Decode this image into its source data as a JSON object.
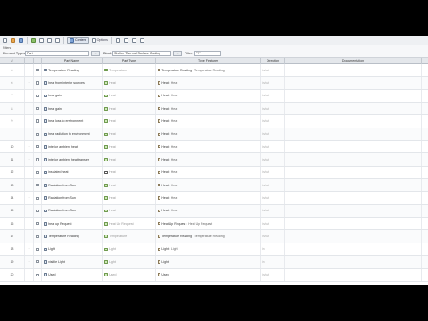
{
  "toolbar": {
    "items": [
      "",
      "",
      "",
      "",
      "",
      "",
      "",
      "",
      ""
    ],
    "toggle_label": "Content",
    "options_label": "Options"
  },
  "filter": {
    "caption": "Filters",
    "element_types_label": "Element Types:",
    "element_types_value": "Part",
    "owner_label": "Block:",
    "owner_value": "Shelter Thermal Surface Cooling",
    "filter_label": "Filter:",
    "filter_value": "\"?\""
  },
  "columns": {
    "num": "#",
    "expand": "",
    "check": "",
    "part_name": "Part Name",
    "part_type": "Part Type",
    "type_features": "Type Features",
    "direction": "Direction",
    "documentation": "Documentation"
  },
  "rows": [
    {
      "num": "6",
      "exp": "",
      "name": "Temperature Reading",
      "type": "Temperature",
      "feat_a": "Temperature Reading",
      "feat_b": "Temperature Reading",
      "dir": "in/out"
    },
    {
      "num": "6",
      "exp": "+",
      "name": "heat from interior sources",
      "type": "Heat",
      "feat_a": "Heat",
      "feat_b": "Heat",
      "dir": "in/out"
    },
    {
      "num": "7",
      "exp": "",
      "name": "heat gain",
      "type": "Heat",
      "feat_a": "Heat",
      "feat_b": "Heat",
      "dir": "in/out"
    },
    {
      "num": "8",
      "exp": "",
      "name": "heat gain",
      "type": "Heat",
      "feat_a": "Heat",
      "feat_b": "Heat",
      "dir": "in/out"
    },
    {
      "num": "9",
      "exp": "",
      "name": "heat loss to environment",
      "type": "Heat",
      "feat_a": "Heat",
      "feat_b": "Heat",
      "dir": "in/out"
    },
    {
      "num": "",
      "exp": "",
      "name": "heat radiation to environment",
      "type": "Heat",
      "feat_a": "Heat",
      "feat_b": "Heat",
      "dir": "in/out"
    },
    {
      "num": "10",
      "exp": "+",
      "name": "interior ambient heat",
      "type": "Heat",
      "feat_a": "Heat",
      "feat_b": "Heat",
      "dir": "in/out"
    },
    {
      "num": "11",
      "exp": "+",
      "name": "interior ambient heat transfer",
      "type": "Heat",
      "feat_a": "Heat",
      "feat_b": "Heat",
      "dir": "in/out"
    },
    {
      "num": "12",
      "exp": "",
      "name": "insulated heat",
      "type": "Heat",
      "feat_a": "Heat",
      "feat_b": "Heat",
      "dir": "in/out"
    },
    {
      "num": "13",
      "exp": "+",
      "name": "Radiation from Sun",
      "type": "Heat",
      "feat_a": "Heat",
      "feat_b": "Heat",
      "dir": "in/out"
    },
    {
      "num": "14",
      "exp": "+",
      "name": "Radiation from Sun",
      "type": "Heat",
      "feat_a": "Heat",
      "feat_b": "Heat",
      "dir": "in/out"
    },
    {
      "num": "15",
      "exp": "+",
      "name": "Radiation from Sun",
      "type": "Heat",
      "feat_a": "Heat",
      "feat_b": "Heat",
      "dir": "in/out"
    },
    {
      "num": "16",
      "exp": "",
      "name": "heat up Request",
      "type": "Heat Up Request",
      "feat_a": "Heat Up Request",
      "feat_b": "Heat Up Request",
      "dir": "in/out"
    },
    {
      "num": "17",
      "exp": "",
      "name": "Temperature Reading",
      "type": "Temperature",
      "feat_a": "Temperature Reading",
      "feat_b": "Temperature Reading",
      "dir": "in/out"
    },
    {
      "num": "18",
      "exp": "+",
      "name": "Light",
      "type": "Light",
      "feat_a": "Light",
      "feat_b": "Light",
      "dir": "in"
    },
    {
      "num": "19",
      "exp": "+",
      "name": "visible Light",
      "type": "Light",
      "feat_a": "Light",
      "feat_b": "",
      "dir": "in"
    },
    {
      "num": "20",
      "exp": "",
      "name": "Used",
      "type": "Used",
      "feat_a": "Used",
      "feat_b": "",
      "dir": "in/out"
    }
  ],
  "colors": {
    "toolbar_bg": "#eef0f3",
    "header_bg": "#e4e7eb",
    "type_text": "#999999"
  }
}
